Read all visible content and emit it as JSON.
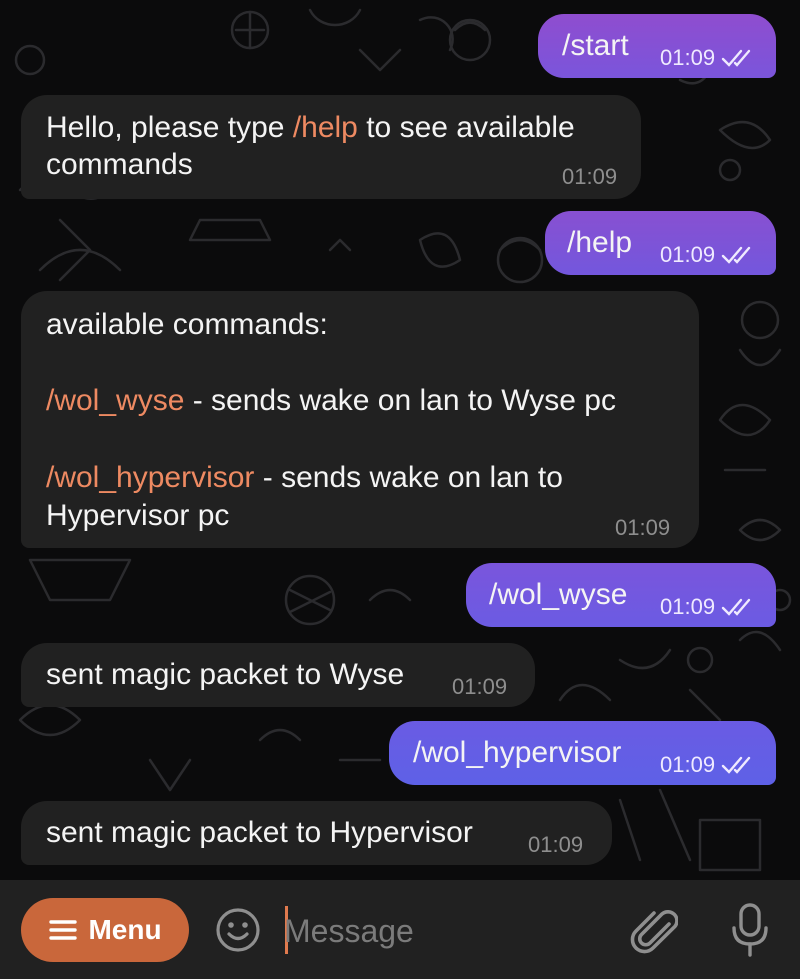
{
  "colors": {
    "incoming_bubble": "#212121",
    "outgoing_gradient_top": "#8a4fd0",
    "outgoing_gradient_bottom": "#5e60e6",
    "command_link": "#ee8a62",
    "menu_button": "#c9673b",
    "input_bar": "#212121"
  },
  "messages": [
    {
      "dir": "out",
      "text": "/start",
      "time": "01:09",
      "status": "read"
    },
    {
      "dir": "in",
      "line1_pre": "Hello, please type ",
      "line1_cmd": "/help",
      "line1_post": " to see available",
      "line2": "commands",
      "time": "01:09"
    },
    {
      "dir": "out",
      "text": "/help",
      "time": "01:09",
      "status": "read"
    },
    {
      "dir": "in",
      "heading": "available commands:",
      "cmd1": "/wol_wyse",
      "cmd1_desc": " - sends wake on lan to Wyse pc",
      "cmd2": "/wol_hypervisor",
      "cmd2_desc": " - sends wake on lan to",
      "cmd2_desc2": "Hypervisor pc",
      "time": "01:09"
    },
    {
      "dir": "out",
      "text": "/wol_wyse",
      "time": "01:09",
      "status": "read"
    },
    {
      "dir": "in",
      "text": "sent magic packet to Wyse",
      "time": "01:09"
    },
    {
      "dir": "out",
      "text": "/wol_hypervisor",
      "time": "01:09",
      "status": "read"
    },
    {
      "dir": "in",
      "text": "sent magic packet to Hypervisor",
      "time": "01:09"
    }
  ],
  "input_bar": {
    "menu_label": "Menu",
    "placeholder": "Message",
    "icons": [
      "hamburger-icon",
      "emoji-icon",
      "paperclip-icon",
      "microphone-icon"
    ]
  }
}
